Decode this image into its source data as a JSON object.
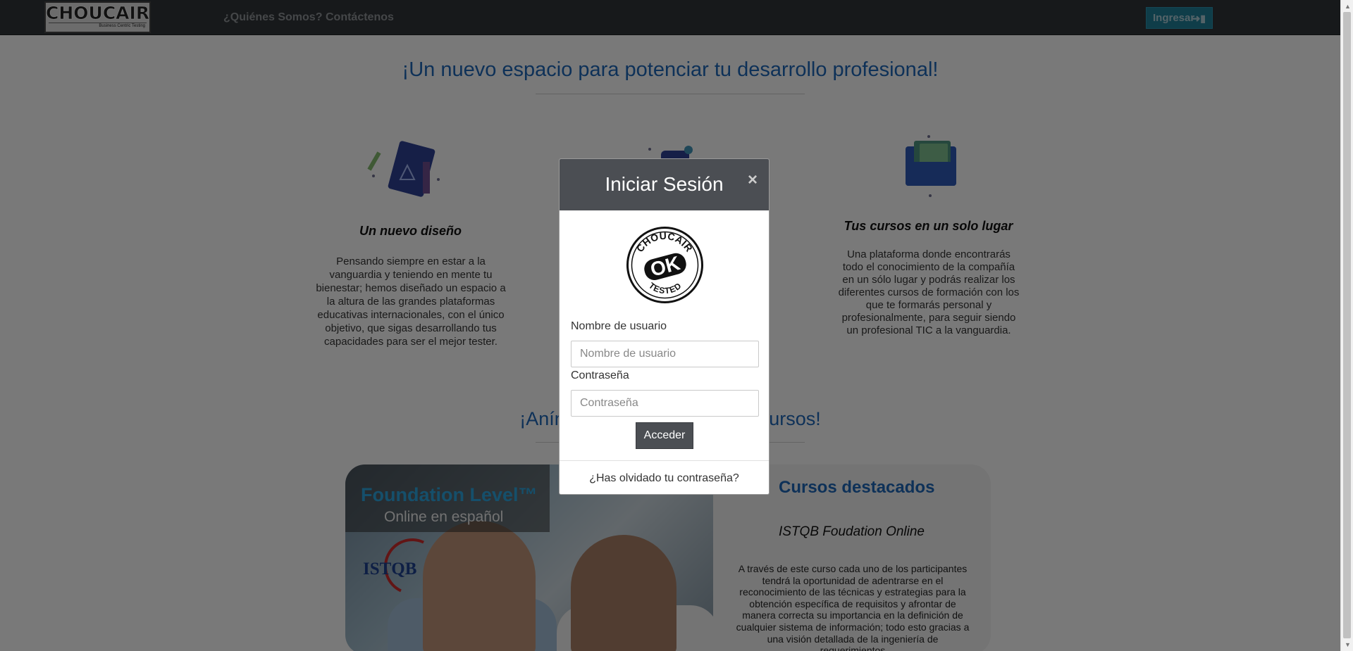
{
  "navbar": {
    "logo_text": "CHOUCAIR",
    "logo_tagline": "Business Centric Testing",
    "links": [
      "¿Quiénes Somos?",
      "Contáctenos"
    ],
    "login_button": "Ingresar"
  },
  "page": {
    "hero_title": "¡Un nuevo espacio para potenciar tu desarrollo profesional!",
    "features": [
      {
        "title": "Un nuevo diseño",
        "text": "Pensando siempre en estar a la vanguardia y teniendo en mente tu bienestar; hemos diseñado un espacio a la altura de las grandes plataformas educativas internacionales, con el único objetivo, que sigas desarrollando tus capacidades para ser el mejor tester."
      },
      {
        "title": "Tus cursos en un solo lugar",
        "text": "Una plataforma donde encontrarás todo el conocimiento de la compañía en un sólo lugar y podrás realizar los diferentes cursos de formación con los que te formarás personal y profesionalmente, para seguir siendo un profesional TIC a la vanguardia."
      }
    ],
    "section_title_left": "¡Anímat",
    "section_title_right": "os cursos!",
    "course_banner_line1": "Foundation Level™",
    "course_banner_line2": "Online en español",
    "course_logo": "ISTQB",
    "featured_heading": "Cursos destacados",
    "featured_course_name": "ISTQB Foudation Online",
    "featured_course_desc": "A través de este curso cada uno de los participantes tendrá la oportunidad de adentrarse en el reconocimiento de las técnicas y estrategias para la obtención específica de requisitos y afrontar de manera correcta su importancia en la definición de cualquier sistema de información; todo esto gracias a una visión detallada de la ingeniería de requerimientos"
  },
  "modal": {
    "title": "Iniciar Sesión",
    "close": "×",
    "logo_top": "CHOUCAIR",
    "logo_mid": "OK",
    "logo_bottom": "TESTED",
    "username_label": "Nombre de usuario",
    "username_placeholder": "Nombre de usuario",
    "username_value": "",
    "password_label": "Contraseña",
    "password_placeholder": "Contraseña",
    "password_value": "",
    "submit_button": "Acceder",
    "forgot_link": "¿Has olvidado tu contraseña?"
  },
  "colors": {
    "navbar_bg": "#2f3336",
    "accent_blue": "#1c63b1",
    "login_button_bg": "#1f7a93",
    "modal_header_bg": "#4b4e53"
  },
  "icons": {
    "login_button_icon": "sign-in-icon",
    "close_icon": "close-icon"
  }
}
